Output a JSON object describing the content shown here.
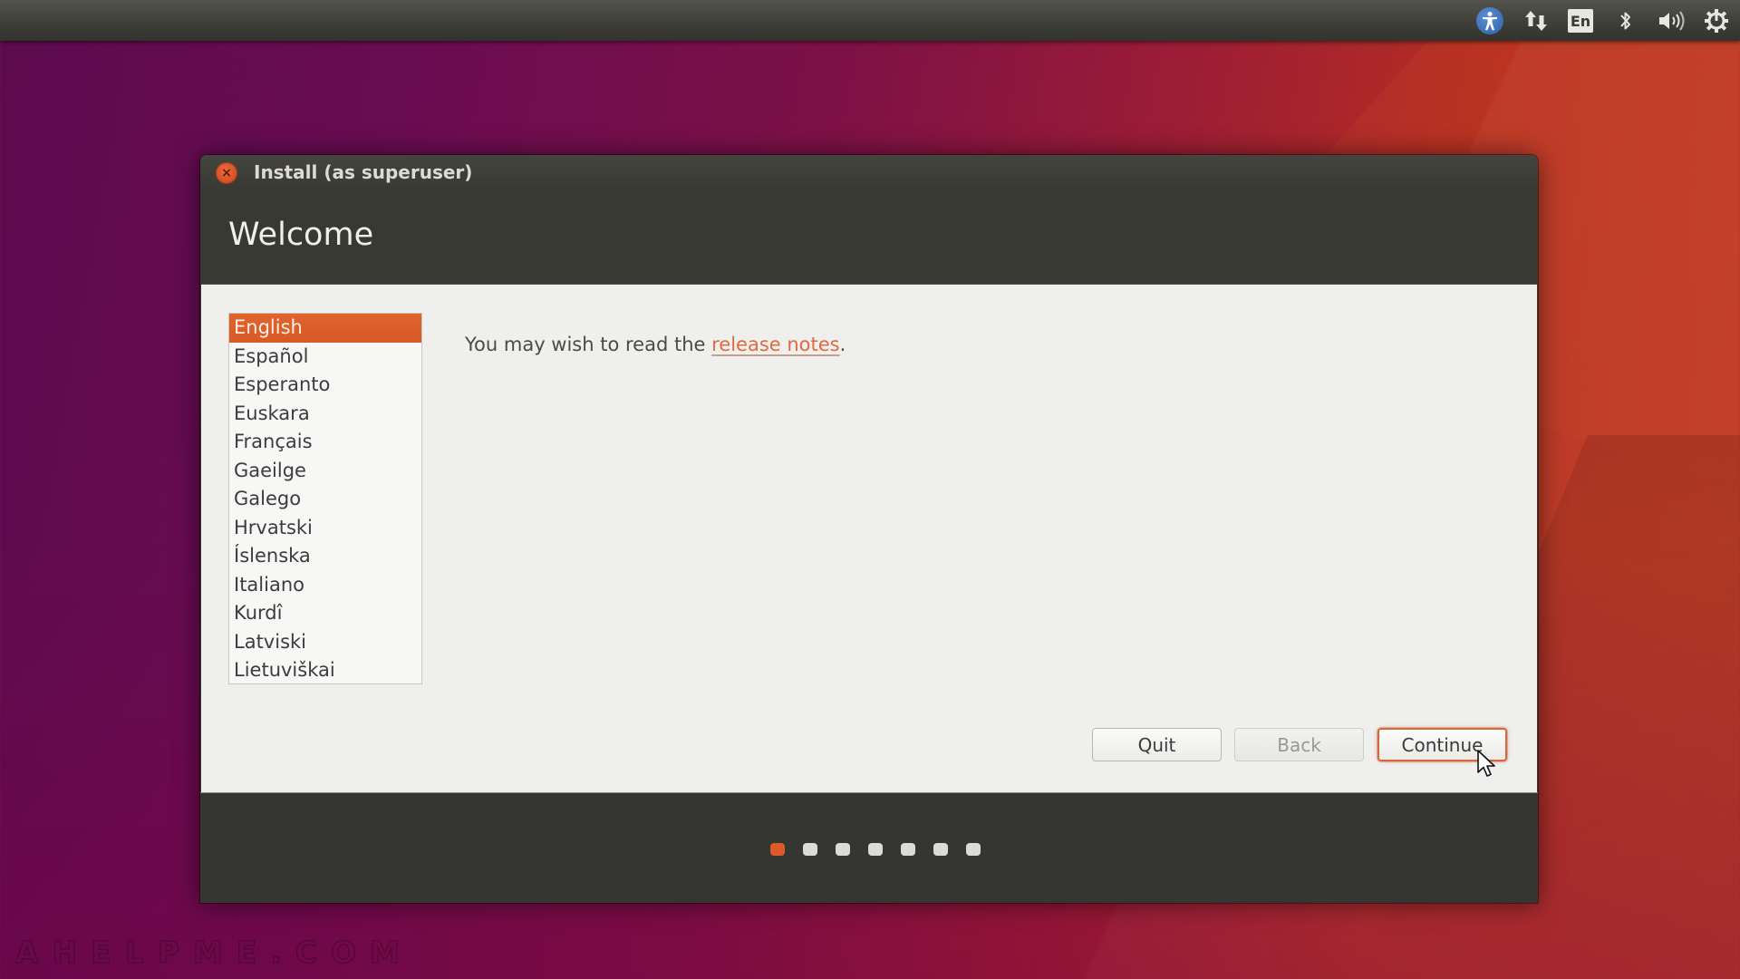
{
  "top_panel": {
    "indicators": [
      {
        "name": "accessibility",
        "icon": "accessibility-icon"
      },
      {
        "name": "network",
        "icon": "network-updown-icon"
      },
      {
        "name": "keyboard-layout",
        "icon": "keyboard-layout-icon",
        "label": "En"
      },
      {
        "name": "bluetooth",
        "icon": "bluetooth-icon"
      },
      {
        "name": "sound",
        "icon": "volume-icon"
      },
      {
        "name": "session",
        "icon": "power-gear-icon"
      }
    ]
  },
  "window": {
    "title": "Install (as superuser)",
    "page_title": "Welcome"
  },
  "languages": {
    "selected": "English",
    "items": [
      "English",
      "Español",
      "Esperanto",
      "Euskara",
      "Français",
      "Gaeilge",
      "Galego",
      "Hrvatski",
      "Íslenska",
      "Italiano",
      "Kurdî",
      "Latviski",
      "Lietuviškai"
    ]
  },
  "main": {
    "release_prefix": "You may wish to read the ",
    "release_link": "release notes",
    "release_suffix": "."
  },
  "buttons": {
    "quit": "Quit",
    "back": "Back",
    "continue": "Continue"
  },
  "progress": {
    "total_steps": 7,
    "current_step": 1
  },
  "colors": {
    "accent": "#df5a2b",
    "link": "#df6b3e",
    "header_bg": "#393934",
    "content_bg": "#efefed"
  },
  "watermark": "AHELPME.COM"
}
